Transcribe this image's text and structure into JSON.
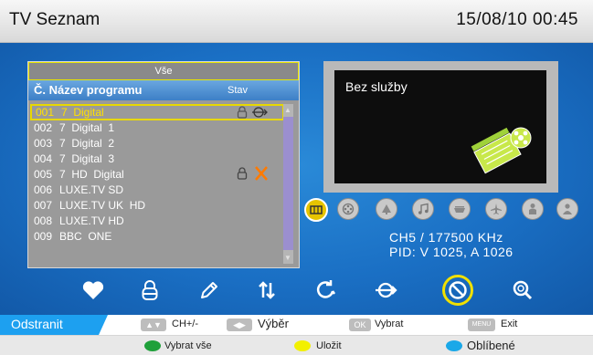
{
  "header": {
    "title": "TV Seznam",
    "datetime": "15/08/10  00:45"
  },
  "list": {
    "filter": "Vše",
    "col_program": "Č. Název programu",
    "col_status": "Stav",
    "rows": [
      {
        "num": "001",
        "name": "7  Digital",
        "selected": true,
        "lock": true,
        "skip": true,
        "delete": false
      },
      {
        "num": "002",
        "name": "7  Digital  1"
      },
      {
        "num": "003",
        "name": "7  Digital  2"
      },
      {
        "num": "004",
        "name": "7  Digital  3"
      },
      {
        "num": "005",
        "name": "7  HD  Digital",
        "lock": true,
        "delete": true
      },
      {
        "num": "006",
        "name": "LUXE.TV SD"
      },
      {
        "num": "007",
        "name": "LUXE.TV UK  HD"
      },
      {
        "num": "008",
        "name": "LUXE.TV HD"
      },
      {
        "num": "009",
        "name": "BBC  ONE"
      }
    ]
  },
  "preview": {
    "message": "Bez služby"
  },
  "channel_info": {
    "line1": "CH5 / 177500  KHz",
    "line2": "PID: V 1025, A 1026"
  },
  "categories": [
    "all-icon",
    "film-icon",
    "news-icon",
    "music-icon",
    "sports-icon",
    "travel-icon",
    "kids-icon",
    "people-icon"
  ],
  "toolbar_icons": [
    "favorite-icon",
    "lock-icon",
    "rename-icon",
    "move-icon",
    "skip-refresh-icon",
    "skip-icon",
    "delete-icon",
    "find-icon"
  ],
  "footer": {
    "mode": "Odstranit",
    "key_updown": "▲▼",
    "ch_label": "CH+/-",
    "key_leftright": "◀▶",
    "select_label": "Výběr",
    "ok_key": "OK",
    "ok_label": "Vybrat",
    "menu_key": "MENU",
    "menu_label": "Exit",
    "green_label": "Vybrat vše",
    "yellow_label": "Uložit",
    "blue_label": "Oblíbené"
  },
  "colors": {
    "accent_yellow": "#e8d800",
    "panel_blue": "#1a6fc4",
    "green": "#1fa03a",
    "yellow": "#f2f000",
    "blue": "#1aa8e8"
  }
}
